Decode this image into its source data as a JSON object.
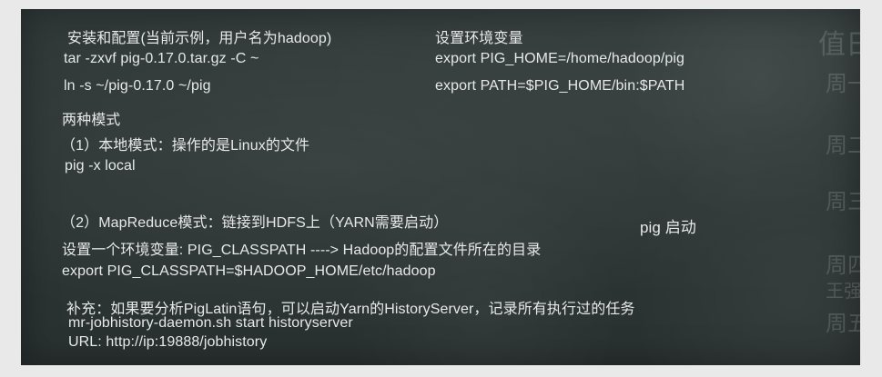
{
  "left_lines": [
    "安装和配置(当前示例，用户名为hadoop)",
    " tar -zxvf pig-0.17.0.tar.gz -C ~",
    " ln -s  ~/pig-0.17.0  ~/pig",
    "两种模式",
    "（1）本地模式：操作的是Linux的文件",
    "pig -x local",
    "（2）MapReduce模式：链接到HDFS上（YARN需要启动）",
    "设置一个环境变量: PIG_CLASSPATH  ----> Hadoop的配置文件所在的目录",
    "export PIG_CLASSPATH=$HADOOP_HOME/etc/hadoop",
    "补充：如果要分析PigLatin语句，可以启动Yarn的HistoryServer，记录所有执行过的任务",
    "mr-jobhistory-daemon.sh start historyserver",
    "URL:  http://ip:19888/jobhistory"
  ],
  "env_title": "设置环境变量",
  "env_lines": [
    "export PIG_HOME=/home/hadoop/pig",
    "export PATH=$PIG_HOME/bin:$PATH"
  ],
  "pig_start": "pig 启动",
  "faint_right": [
    "值日",
    "周一",
    "周二",
    "周三",
    "周四",
    "王强",
    "周五"
  ]
}
